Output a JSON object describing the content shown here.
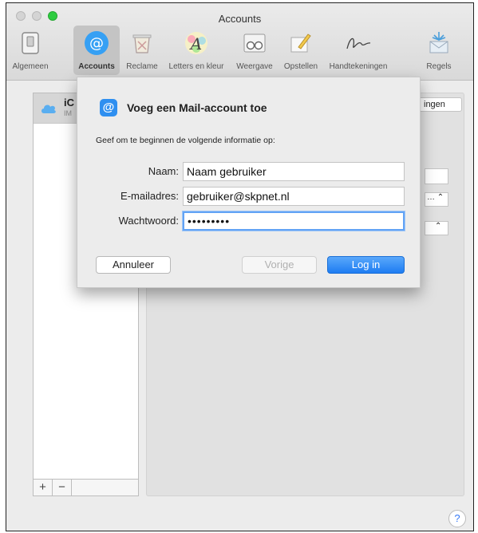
{
  "window": {
    "title": "Accounts"
  },
  "toolbar": {
    "items": [
      {
        "label": "Algemeen",
        "icon": "switch-icon"
      },
      {
        "label": "Accounts",
        "icon": "at-icon",
        "active": true
      },
      {
        "label": "Reclame",
        "icon": "trash-icon"
      },
      {
        "label": "Letters en kleur",
        "icon": "font-color-icon"
      },
      {
        "label": "Weergave",
        "icon": "glasses-icon"
      },
      {
        "label": "Opstellen",
        "icon": "pencil-icon"
      },
      {
        "label": "Handtekeningen",
        "icon": "signature-icon"
      },
      {
        "label": "Regels",
        "icon": "rules-icon"
      }
    ]
  },
  "account_list": {
    "first_row_name": "iC",
    "first_row_sub": "IM",
    "add_label": "+",
    "remove_label": "−"
  },
  "detail": {
    "tab_label": "ingen"
  },
  "dialog": {
    "title": "Voeg een Mail-account toe",
    "subtitle": "Geef om te beginnen de volgende informatie op:",
    "name_label": "Naam:",
    "name_value": "Naam gebruiker",
    "email_label": "E-mailadres:",
    "email_value": "gebruiker@skpnet.nl",
    "password_label": "Wachtwoord:",
    "password_value": "•••••••••",
    "cancel_label": "Annuleer",
    "prev_label": "Vorige",
    "login_label": "Log in"
  },
  "help_label": "?",
  "colors": {
    "accent": "#1d7cf2",
    "window_bg": "#ececec"
  }
}
